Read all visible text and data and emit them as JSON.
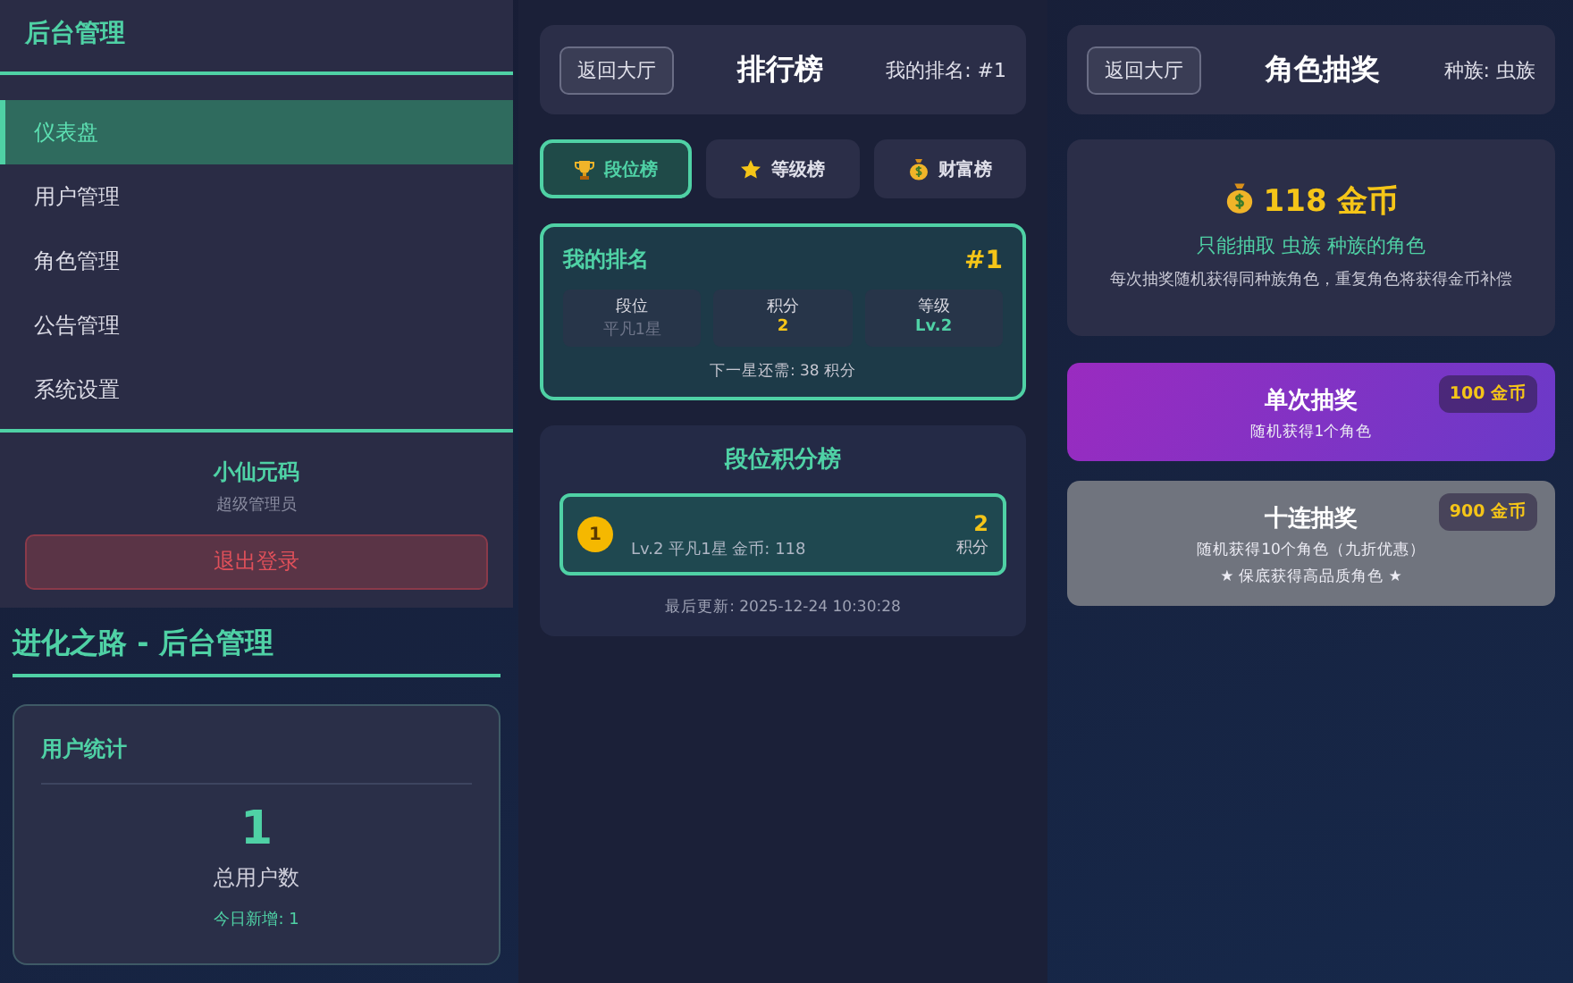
{
  "sidebar": {
    "title": "后台管理",
    "items": [
      {
        "label": "仪表盘",
        "selected": true
      },
      {
        "label": "用户管理",
        "selected": false
      },
      {
        "label": "角色管理",
        "selected": false
      },
      {
        "label": "公告管理",
        "selected": false
      },
      {
        "label": "系统设置",
        "selected": false
      }
    ],
    "user": {
      "name": "小仙元码",
      "role": "超级管理员"
    },
    "logout": "退出登录"
  },
  "admin": {
    "title": "进化之路 - 后台管理",
    "card": {
      "title": "用户统计",
      "value": "1",
      "label": "总用户数",
      "today": "今日新增: 1"
    }
  },
  "ranking": {
    "back": "返回大厅",
    "title": "排行榜",
    "my_rank": "我的排名: #1",
    "tabs": [
      {
        "label": "段位榜",
        "kind": "trophy",
        "selected": true
      },
      {
        "label": "等级榜",
        "kind": "star",
        "selected": false
      },
      {
        "label": "财富榜",
        "kind": "moneybag",
        "selected": false
      }
    ],
    "mine": {
      "title": "我的排名",
      "rank": "#1",
      "stats": [
        {
          "label": "段位",
          "value": "平凡1星",
          "kind": "muted"
        },
        {
          "label": "积分",
          "value": "2",
          "kind": "gold"
        },
        {
          "label": "等级",
          "value": "Lv.2",
          "kind": "green"
        }
      ],
      "next": "下一星还需: 38 积分"
    },
    "board": {
      "title": "段位积分榜",
      "rows": [
        {
          "rank": "1",
          "detail": "Lv.2 平凡1星 金币: 118",
          "score": "2",
          "unit": "积分"
        }
      ],
      "updated": "最后更新: 2025-12-24 10:30:28"
    }
  },
  "gacha": {
    "back": "返回大厅",
    "title": "角色抽奖",
    "race": "种族: 虫族",
    "coins": "118 金币",
    "rule": "只能抽取 虫族 种族的角色",
    "note": "每次抽奖随机获得同种族角色，重复角色将获得金币补偿",
    "draws": [
      {
        "title": "单次抽奖",
        "desc": [
          "随机获得1个角色"
        ],
        "price": "100 金币",
        "disabled": false
      },
      {
        "title": "十连抽奖",
        "desc": [
          "随机获得10个角色（九折优惠）",
          "★ 保底获得高品质角色 ★"
        ],
        "price": "900 金币",
        "disabled": true
      }
    ]
  }
}
